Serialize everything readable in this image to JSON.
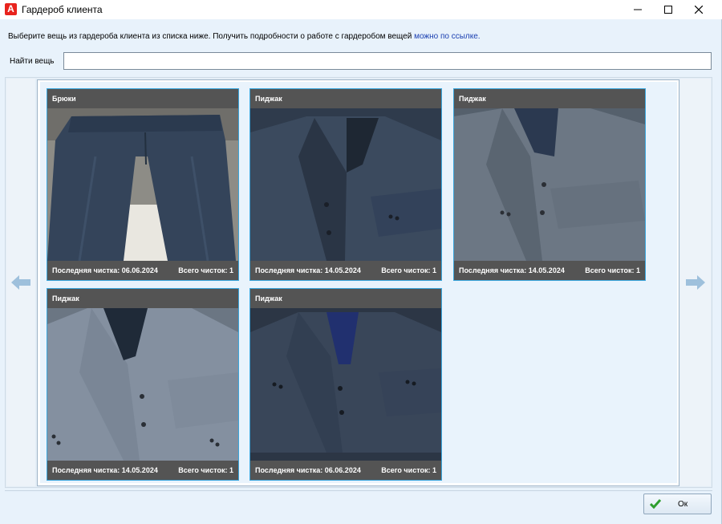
{
  "window": {
    "title": "Гардероб клиента",
    "accent": "#e8231d"
  },
  "description": {
    "text": "Выберите вещь из гардероба клиента из списка ниже. Получить подробности о работе с гардеробом вещей",
    "link": "можно по ссылке."
  },
  "search": {
    "label": "Найти вещь",
    "value": ""
  },
  "gallery": {
    "items": [
      {
        "title": "Брюки",
        "last_clean": "Последняя чистка: 06.06.2024",
        "total": "Всего чисток: 1",
        "image": "trousers"
      },
      {
        "title": "Пиджак",
        "last_clean": "Последняя чистка: 14.05.2024",
        "total": "Всего чисток: 1",
        "image": "jacket"
      },
      {
        "title": "Пиджак",
        "last_clean": "Последняя чистка: 14.05.2024",
        "total": "Всего чисток: 1",
        "image": "jacket"
      },
      {
        "title": "Пиджак",
        "last_clean": "Последняя чистка: 14.05.2024",
        "total": "Всего чисток: 1",
        "image": "jacket"
      },
      {
        "title": "Пиджак",
        "last_clean": "Последняя чистка: 06.06.2024",
        "total": "Всего чисток: 1",
        "image": "jacket"
      }
    ],
    "card_border_color": "#3aa6dd",
    "card_bar_color": "#545454"
  },
  "footer": {
    "ok_label": "Ок"
  }
}
